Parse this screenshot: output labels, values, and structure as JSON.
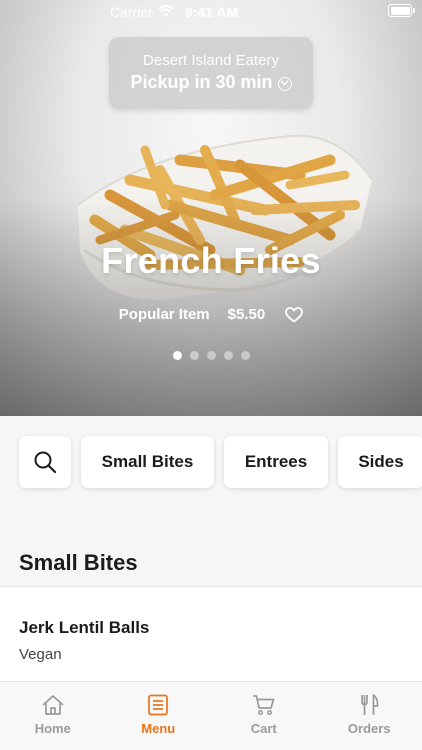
{
  "status_bar": {
    "carrier": "Carrier",
    "time": "9:41 AM"
  },
  "location": {
    "name": "Desert Island Eatery",
    "pickup": "Pickup in 30 min"
  },
  "hero": {
    "title": "French Fries",
    "badge": "Popular Item",
    "price": "$5.50",
    "page_count": 5,
    "active_page": 1
  },
  "categories": [
    "Small Bites",
    "Entrees",
    "Sides"
  ],
  "section": {
    "title": "Small Bites"
  },
  "items": [
    {
      "name": "Jerk Lentil Balls",
      "tag": "Vegan"
    }
  ],
  "tabs": [
    {
      "label": "Home",
      "icon": "home-icon"
    },
    {
      "label": "Menu",
      "icon": "menu-list-icon"
    },
    {
      "label": "Cart",
      "icon": "cart-icon"
    },
    {
      "label": "Orders",
      "icon": "fork-knife-icon"
    }
  ],
  "active_tab": "Menu",
  "colors": {
    "accent": "#e8731b",
    "inactive": "#9a9a9a",
    "chip_bg": "#ffffff",
    "page_bg": "#f6f6f6"
  }
}
